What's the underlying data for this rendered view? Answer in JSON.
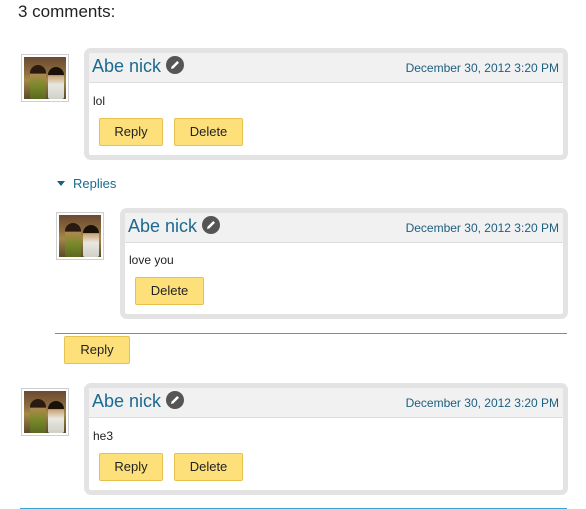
{
  "comments_heading": "3 comments:",
  "comments": [
    {
      "author": "Abe nick",
      "timestamp": "December 30, 2012 3:20 PM",
      "text": "lol",
      "reply_label": "Reply",
      "delete_label": "Delete"
    },
    {
      "author": "Abe nick",
      "timestamp": "December 30, 2012 3:20 PM",
      "text": "he3",
      "reply_label": "Reply",
      "delete_label": "Delete"
    }
  ],
  "replies": {
    "toggle_label": "Replies",
    "items": [
      {
        "author": "Abe nick",
        "timestamp": "December 30, 2012 3:20 PM",
        "text": "love you",
        "delete_label": "Delete"
      }
    ],
    "reply_label": "Reply"
  },
  "icons": {
    "edit": "pencil-icon",
    "toggle": "triangle-down-icon"
  },
  "colors": {
    "link": "#1c6a8f",
    "button": "#fde07a",
    "divider": "#3aa5d4"
  }
}
